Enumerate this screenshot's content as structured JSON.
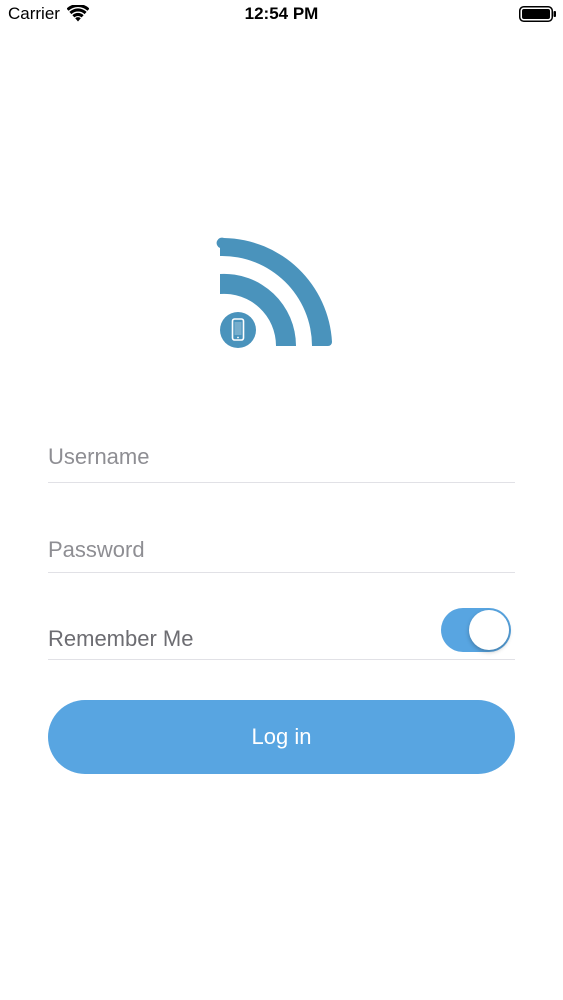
{
  "status_bar": {
    "carrier": "Carrier",
    "time": "12:54 PM",
    "icons": [
      "wifi-icon",
      "battery-icon"
    ]
  },
  "logo": {
    "icon": "wifi-phone-logo",
    "color": "#4a93bc"
  },
  "form": {
    "username_placeholder": "Username",
    "username_value": "",
    "password_placeholder": "Password",
    "password_value": "",
    "remember_label": "Remember Me",
    "remember_on": true,
    "login_label": "Log in"
  },
  "colors": {
    "accent": "#58a5e1",
    "logo": "#4a93bc",
    "placeholder": "#8e8e93",
    "divider": "#e1e1e6"
  }
}
